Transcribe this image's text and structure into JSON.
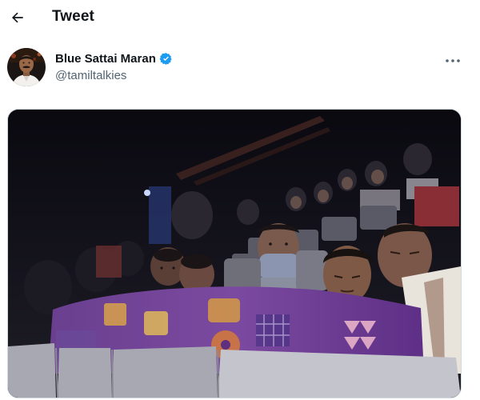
{
  "header": {
    "title": "Tweet",
    "back_icon": "arrow-left-icon"
  },
  "author": {
    "display_name": "Blue Sattai Maran",
    "handle": "@tamiltalkies",
    "verified_icon": "verified-badge-icon",
    "verified_color": "#1d9bf0",
    "more_icon": "more-horizontal-icon"
  },
  "media": {
    "kind": "photo"
  },
  "colors": {
    "text": "#0f1419",
    "secondary": "#536471",
    "border": "#cfd9de"
  }
}
